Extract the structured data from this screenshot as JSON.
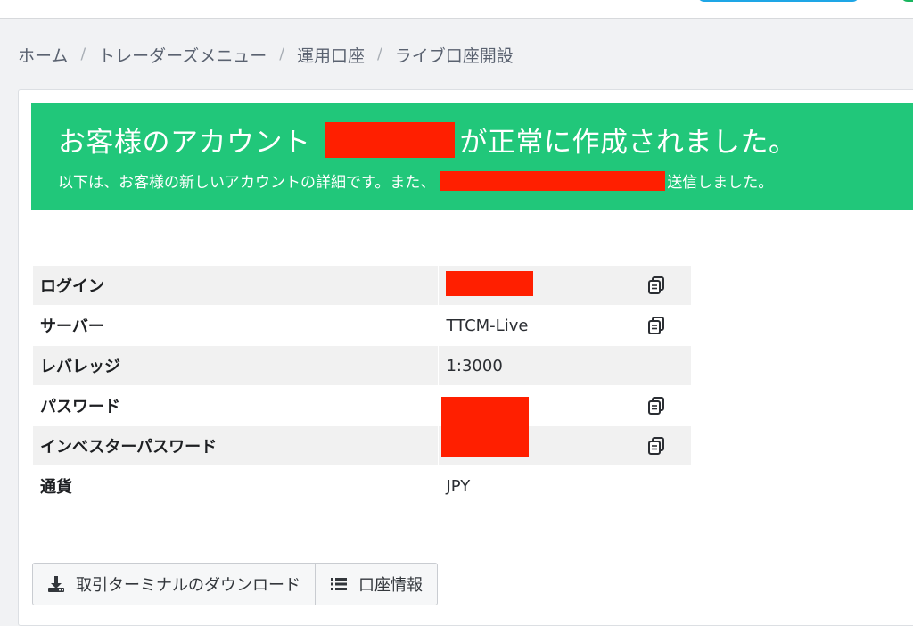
{
  "colors": {
    "banner": "#21c77a",
    "redaction": "#ff1f00",
    "row_alt": "#f1f1f1"
  },
  "breadcrumb": [
    {
      "label": "ホーム"
    },
    {
      "label": "トレーダーズメニュー"
    },
    {
      "label": "運用口座"
    },
    {
      "label": "ライブ口座開設"
    }
  ],
  "breadcrumb_separator": "/",
  "banner": {
    "title_prefix": "お客様のアカウント",
    "title_suffix": "が正常に作成されました。",
    "subtitle_prefix": "以下は、お客様の新しいアカウントの詳細です。また、",
    "subtitle_suffix": "送信しました。"
  },
  "details": {
    "rows": [
      {
        "label": "ログイン",
        "value": "",
        "redacted": true,
        "copy_icon": "copy-icon"
      },
      {
        "label": "サーバー",
        "value": "TTCM-Live",
        "redacted": false,
        "copy_icon": "copy-icon"
      },
      {
        "label": "レバレッジ",
        "value": "1:3000",
        "redacted": false,
        "copy_icon": ""
      },
      {
        "label": "パスワード",
        "value": "",
        "redacted": true,
        "copy_icon": "copy-icon"
      },
      {
        "label": "インベスターパスワード",
        "value": "",
        "redacted": true,
        "copy_icon": "copy-icon"
      },
      {
        "label": "通貨",
        "value": "JPY",
        "redacted": false,
        "copy_icon": ""
      }
    ]
  },
  "actions": {
    "download_label": "取引ターミナルのダウンロード",
    "download_icon": "download-icon",
    "account_info_label": "口座情報",
    "account_info_icon": "list-icon"
  }
}
